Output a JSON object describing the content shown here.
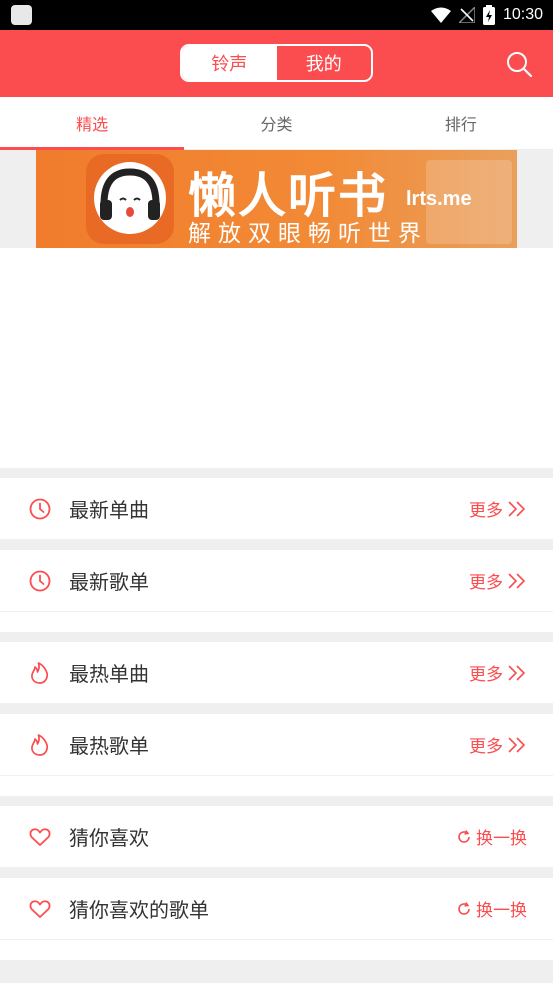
{
  "status_bar": {
    "time": "10:30",
    "icons": [
      "app-icon",
      "wifi-icon",
      "no-signal-icon",
      "battery-charging-icon"
    ]
  },
  "header": {
    "segments": [
      {
        "label": "铃声",
        "active": true
      },
      {
        "label": "我的",
        "active": false
      }
    ],
    "search_icon": "search-icon",
    "bg_color": "#fb4c4f"
  },
  "tabs": [
    {
      "label": "精选",
      "active": true
    },
    {
      "label": "分类",
      "active": false
    },
    {
      "label": "排行",
      "active": false
    }
  ],
  "banner": {
    "title": "懒人听书",
    "domain": "lrts.me",
    "slogan": "解放双眼畅听世界"
  },
  "sections": [
    {
      "label": "最新单曲",
      "icon": "clock-icon",
      "action": "更多",
      "action_icon": "double-chevron-right-icon"
    },
    {
      "label": "最新歌单",
      "icon": "clock-icon",
      "action": "更多",
      "action_icon": "double-chevron-right-icon"
    },
    {
      "label": "最热单曲",
      "icon": "flame-icon",
      "action": "更多",
      "action_icon": "double-chevron-right-icon"
    },
    {
      "label": "最热歌单",
      "icon": "flame-icon",
      "action": "更多",
      "action_icon": "double-chevron-right-icon"
    },
    {
      "label": "猜你喜欢",
      "icon": "heart-icon",
      "action": "换一换",
      "action_icon": "refresh-icon"
    },
    {
      "label": "猜你喜欢的歌单",
      "icon": "heart-icon",
      "action": "换一换",
      "action_icon": "refresh-icon"
    }
  ],
  "colors": {
    "accent": "#fb4c4f",
    "divider": "#efefef"
  }
}
